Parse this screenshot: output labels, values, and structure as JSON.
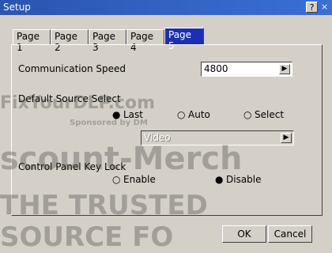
{
  "window": {
    "title": "Setup",
    "help_label": "?",
    "close_label": "×"
  },
  "tabs": [
    {
      "label": "Page 1"
    },
    {
      "label": "Page 2"
    },
    {
      "label": "Page 3"
    },
    {
      "label": "Page 4"
    },
    {
      "label": "Page 5"
    }
  ],
  "comm": {
    "label": "Communication Speed",
    "value": "4800"
  },
  "source": {
    "label": "Default Source Select",
    "options": [
      "Last",
      "Auto",
      "Select"
    ],
    "selected": "Last",
    "combo_value": "Video"
  },
  "lock": {
    "label": "Control Panel Key Lock",
    "options": [
      "Enable",
      "Disable"
    ],
    "selected": "Disable"
  },
  "buttons": {
    "ok": "OK",
    "cancel": "Cancel"
  },
  "watermarks": {
    "fixyourdlp": "FixYourDLP.com",
    "sponsored": "Sponsored by DM",
    "merchant": "scount-Merch",
    "trusted": "THE TRUSTED SOURCE FO"
  },
  "icons": {
    "selected_radio": "●",
    "unselected_radio": "○",
    "combo_arrow": "▶"
  }
}
